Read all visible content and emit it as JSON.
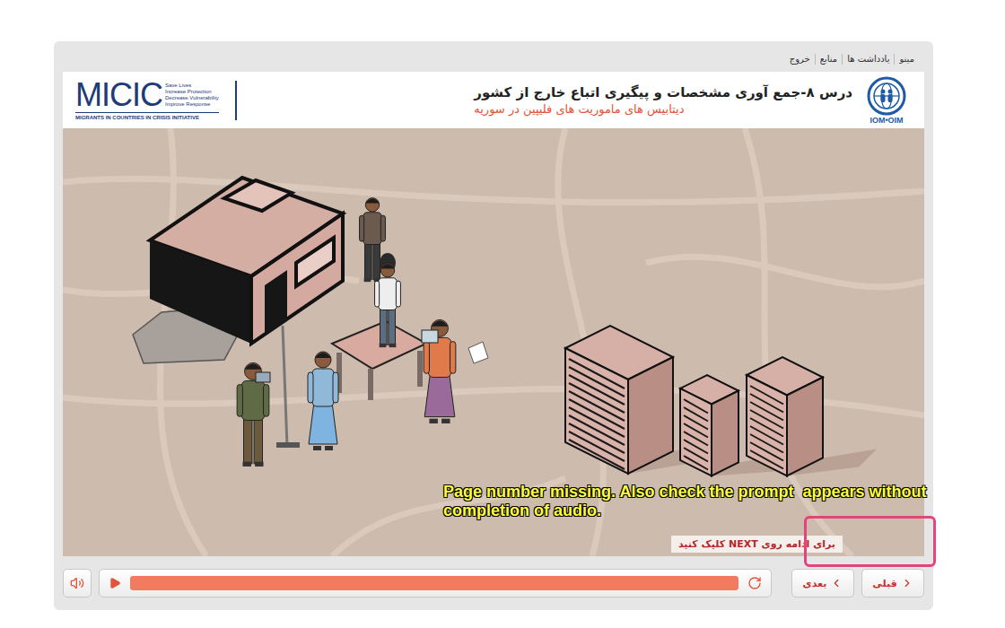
{
  "top_menu": [
    {
      "label": "مینو"
    },
    {
      "label": "یادداشت ها"
    },
    {
      "label": "منابع"
    },
    {
      "label": "خروج"
    }
  ],
  "header": {
    "title": "درس ۸-جمع آوری مشخصات و پیگیری اتباع خارج از کشور",
    "subtitle": "دیتابیس های ماموریت های فلیپین در سوریه",
    "micic": {
      "name": "MICIC",
      "taglines": [
        "Save Lives",
        "Increase Protection",
        "Decrease Vulnerability",
        "Improve Response"
      ],
      "full_name": "MIGRANTS IN COUNTRIES IN CRISIS INITIATIVE"
    },
    "iom": {
      "label": "IOM•OIM"
    }
  },
  "prompt": "برای ادامه روی NEXT کلیک کنید",
  "annotation": "Page number missing. Also check the prompt  appears without completion of audio.",
  "player": {
    "muted": false,
    "progress": {
      "level": 1
    },
    "buttons": [
      {
        "label": "بعدی"
      },
      {
        "label": "قبلی"
      }
    ]
  }
}
